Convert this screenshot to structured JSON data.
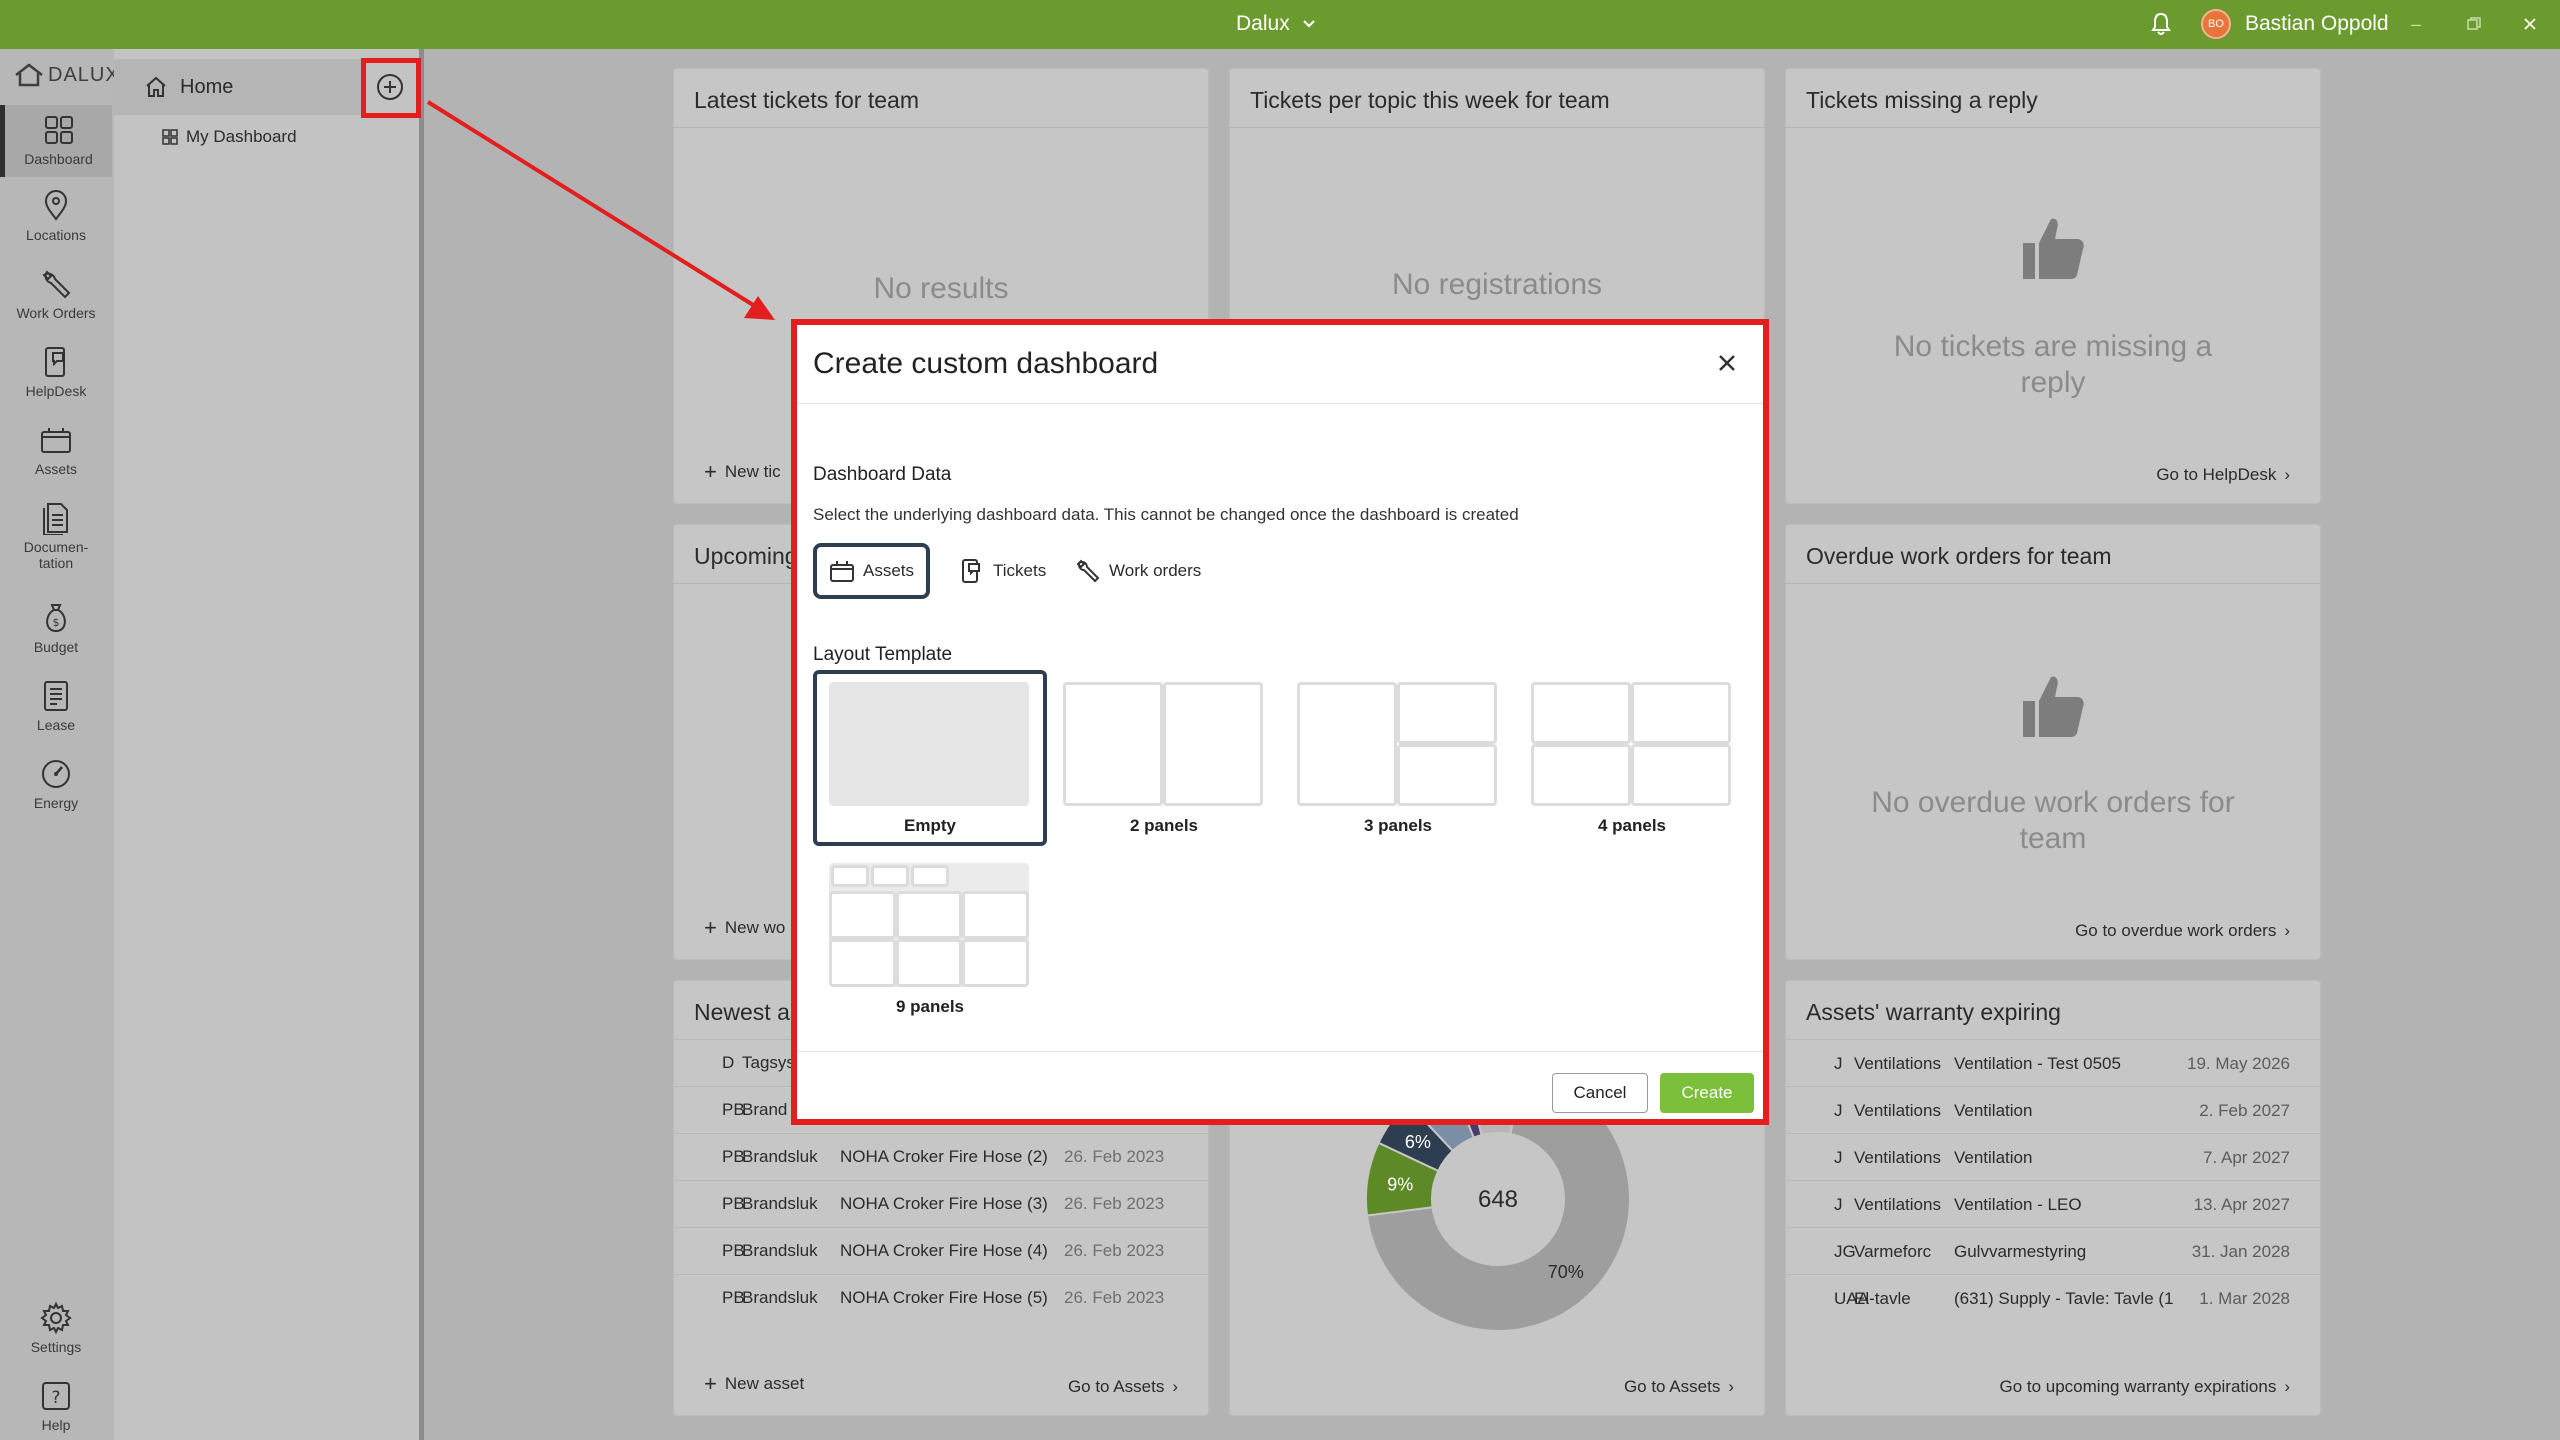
{
  "titlebar": {
    "app_title": "Dalux",
    "user_initials": "BO",
    "user_name": "Bastian Oppold",
    "colors": {
      "bar": "#6b9a2e",
      "avatar": "#e8743b"
    }
  },
  "rail": {
    "logo_text": "DALUX",
    "items": [
      {
        "label": "Dashboard",
        "icon": "grid-icon"
      },
      {
        "label": "Locations",
        "icon": "location-pin-icon"
      },
      {
        "label": "Work Orders",
        "icon": "wrench-icon"
      },
      {
        "label": "HelpDesk",
        "icon": "helpdesk-icon"
      },
      {
        "label": "Assets",
        "icon": "assets-icon"
      },
      {
        "label": "Documen-",
        "label2": "tation",
        "icon": "document-icon"
      },
      {
        "label": "Budget",
        "icon": "money-bag-icon"
      },
      {
        "label": "Lease",
        "icon": "lease-icon"
      },
      {
        "label": "Energy",
        "icon": "gauge-icon"
      },
      {
        "label": "Settings",
        "icon": "gear-icon"
      },
      {
        "label": "Help",
        "icon": "help-icon"
      }
    ]
  },
  "subnav": {
    "home_label": "Home",
    "my_dashboard_label": "My Dashboard"
  },
  "cards": {
    "latest_tickets": {
      "title": "Latest tickets for team",
      "empty": "No results",
      "footer": "New tic"
    },
    "tickets_per_topic": {
      "title": "Tickets per topic this week for team",
      "empty": "No registrations"
    },
    "tickets_missing": {
      "title": "Tickets missing a reply",
      "empty_line1": "No tickets are missing a",
      "empty_line2": "reply",
      "footer": "Go to HelpDesk"
    },
    "upcoming": {
      "title": "Upcoming",
      "footer": "New wo"
    },
    "overdue": {
      "title": "Overdue work orders for team",
      "empty_line1": "No overdue work orders for",
      "empty_line2": "team",
      "footer": "Go to overdue work orders"
    },
    "newest_assets": {
      "title": "Newest as",
      "rows": [
        {
          "c1": "D",
          "c2": "Tagsys",
          "c3": "",
          "c4": ""
        },
        {
          "c1": "PB",
          "c2": "Brand",
          "c3": "",
          "c4": ""
        },
        {
          "c1": "PB",
          "c2": "Brandsluk",
          "c3": "NOHA Croker Fire Hose (2)",
          "c4": "26. Feb 2023"
        },
        {
          "c1": "PB",
          "c2": "Brandsluk",
          "c3": "NOHA Croker Fire Hose (3)",
          "c4": "26. Feb 2023"
        },
        {
          "c1": "PB",
          "c2": "Brandsluk",
          "c3": "NOHA Croker Fire Hose (4)",
          "c4": "26. Feb 2023"
        },
        {
          "c1": "PB",
          "c2": "Brandsluk",
          "c3": "NOHA Croker Fire Hose (5)",
          "c4": "26. Feb 2023"
        }
      ],
      "footer_left": "New asset",
      "footer_right": "Go to Assets"
    },
    "asset_chart": {
      "center_label": "648",
      "footer": "Go to Assets"
    },
    "warranty": {
      "title": "Assets' warranty expiring",
      "rows": [
        {
          "w1": "J",
          "w2": "Ventilations",
          "w3": "Ventilation - Test 0505",
          "w4": "19. May 2026"
        },
        {
          "w1": "J",
          "w2": "Ventilations",
          "w3": "Ventilation",
          "w4": "2. Feb 2027"
        },
        {
          "w1": "J",
          "w2": "Ventilations",
          "w3": "Ventilation",
          "w4": "7. Apr 2027"
        },
        {
          "w1": "J",
          "w2": "Ventilations",
          "w3": "Ventilation - LEO",
          "w4": "13. Apr 2027"
        },
        {
          "w1": "JG",
          "w2": "Varmeforc",
          "w3": "Gulvvarmestyring",
          "w4": "31. Jan 2028"
        },
        {
          "w1": "UAA",
          "w2": "El-tavle",
          "w3": "(631) Supply - Tavle: Tavle (1",
          "w4": "1. Mar 2028"
        }
      ],
      "footer": "Go to upcoming warranty expirations"
    }
  },
  "chart_data": {
    "type": "pie",
    "slices": [
      {
        "label": "70%",
        "value": 70,
        "color": "#9e9e9e"
      },
      {
        "label": "9%",
        "value": 9,
        "color": "#5d8a26"
      },
      {
        "label": "6%",
        "value": 6,
        "color": "#2d3e50"
      },
      {
        "label": "6%",
        "value": 6,
        "color": "#7a8fa6"
      },
      {
        "label": "",
        "value": 2,
        "color": "#4a3d6e"
      },
      {
        "label": "",
        "value": 7,
        "color": "#b6b6b6"
      }
    ],
    "center": "648"
  },
  "modal": {
    "title": "Create custom dashboard",
    "data_section_title": "Dashboard Data",
    "data_section_desc": "Select the underlying dashboard data. This cannot be changed once the dashboard is created",
    "data_options": [
      {
        "label": "Assets",
        "icon": "assets-icon",
        "selected": true
      },
      {
        "label": "Tickets",
        "icon": "helpdesk-icon",
        "selected": false
      },
      {
        "label": "Work orders",
        "icon": "wrench-icon",
        "selected": false
      }
    ],
    "layout_section_title": "Layout Template",
    "templates": [
      {
        "label": "Empty",
        "selected": true
      },
      {
        "label": "2 panels",
        "selected": false
      },
      {
        "label": "3 panels",
        "selected": false
      },
      {
        "label": "4 panels",
        "selected": false
      },
      {
        "label": "9 panels",
        "selected": false
      }
    ],
    "cancel_label": "Cancel",
    "create_label": "Create",
    "colors": {
      "highlight": "#e41e1e",
      "selected_border": "#2d3e50",
      "create_button": "#7bbf3a"
    }
  }
}
